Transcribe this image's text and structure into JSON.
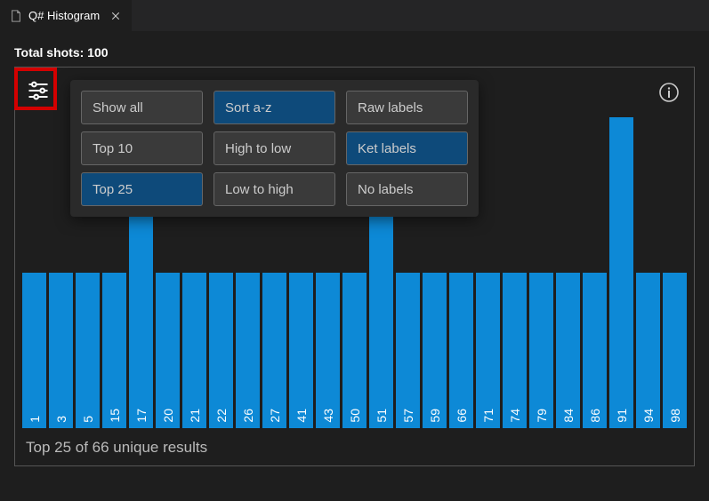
{
  "tab": {
    "title": "Q# Histogram"
  },
  "header": {
    "total_shots_label": "Total shots: 100"
  },
  "menu": {
    "col1": [
      {
        "label": "Show all",
        "active": false
      },
      {
        "label": "Top 10",
        "active": false
      },
      {
        "label": "Top 25",
        "active": true
      }
    ],
    "col2": [
      {
        "label": "Sort a-z",
        "active": true
      },
      {
        "label": "High to low",
        "active": false
      },
      {
        "label": "Low to high",
        "active": false
      }
    ],
    "col3": [
      {
        "label": "Raw labels",
        "active": false
      },
      {
        "label": "Ket labels",
        "active": true
      },
      {
        "label": "No labels",
        "active": false
      }
    ]
  },
  "footer": {
    "text": "Top 25 of 66 unique results"
  },
  "chart_data": {
    "type": "bar",
    "title": "Q# Histogram",
    "xlabel": "",
    "ylabel": "",
    "ylim": [
      0,
      4
    ],
    "categories": [
      "1",
      "3",
      "5",
      "15",
      "17",
      "20",
      "21",
      "22",
      "26",
      "27",
      "41",
      "43",
      "50",
      "51",
      "57",
      "59",
      "66",
      "71",
      "74",
      "79",
      "84",
      "86",
      "91",
      "94",
      "98"
    ],
    "values": [
      2,
      2,
      2,
      2,
      3,
      2,
      2,
      2,
      2,
      2,
      2,
      2,
      2,
      3,
      2,
      2,
      2,
      2,
      2,
      2,
      2,
      2,
      4,
      2,
      2
    ]
  }
}
